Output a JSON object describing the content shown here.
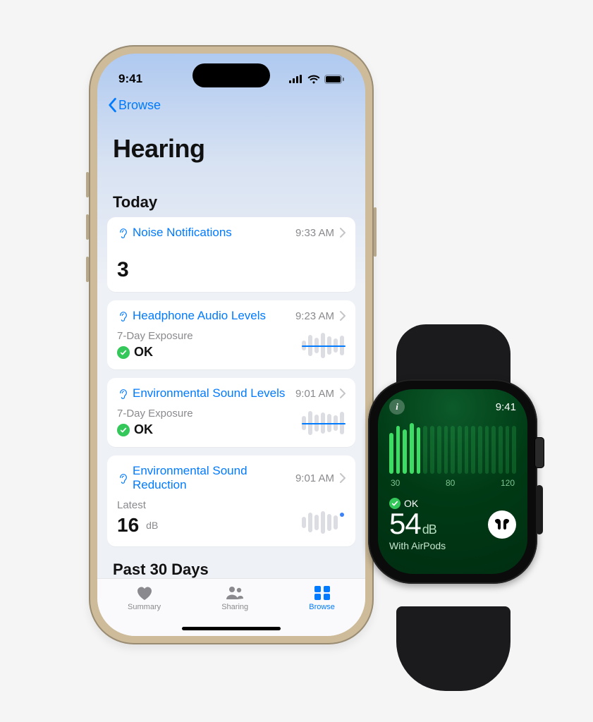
{
  "phone": {
    "status": {
      "time": "9:41"
    },
    "nav": {
      "back_label": "Browse"
    },
    "title": "Hearing",
    "sections": {
      "today_label": "Today",
      "past_label": "Past 30 Days"
    },
    "cards": [
      {
        "title": "Noise Notifications",
        "time": "9:33 AM",
        "value": "3"
      },
      {
        "title": "Headphone Audio Levels",
        "time": "9:23 AM",
        "subtitle": "7-Day Exposure",
        "status": "OK"
      },
      {
        "title": "Environmental Sound Levels",
        "time": "9:01 AM",
        "subtitle": "7-Day Exposure",
        "status": "OK"
      },
      {
        "title": "Environmental Sound Reduction",
        "time": "9:01 AM",
        "subtitle": "Latest",
        "value": "16",
        "unit": "dB"
      }
    ],
    "tabs": {
      "summary": "Summary",
      "sharing": "Sharing",
      "browse": "Browse"
    }
  },
  "watch": {
    "time": "9:41",
    "scale": {
      "min": "30",
      "mid": "80",
      "max": "120"
    },
    "status": "OK",
    "value": "54",
    "unit": "dB",
    "sub": "With AirPods"
  }
}
